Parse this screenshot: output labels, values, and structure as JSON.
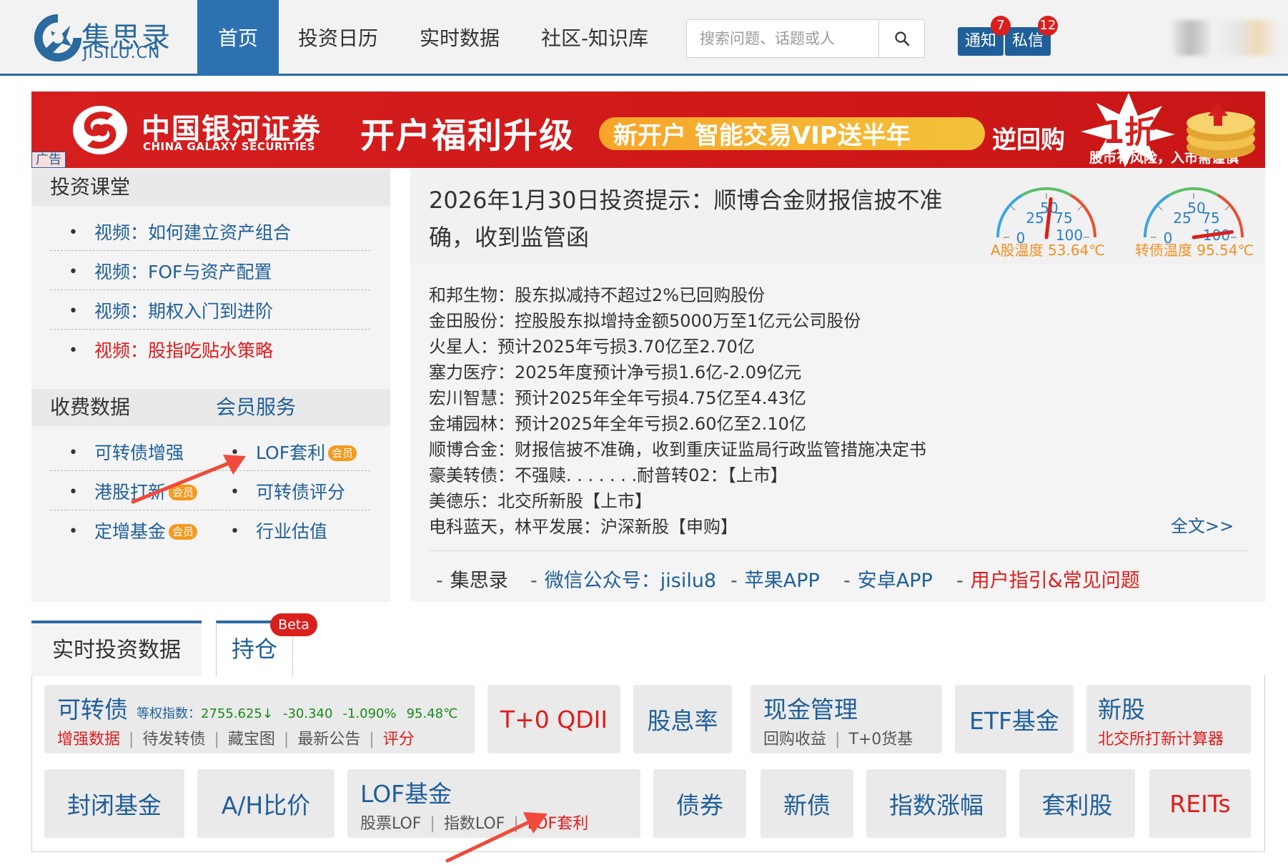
{
  "header": {
    "logo_cn": "集思录",
    "logo_en": "JISILU.CN",
    "nav": [
      "首页",
      "投资日历",
      "实时数据",
      "社区-知识库"
    ],
    "search_placeholder": "搜索问题、话题或人",
    "notice_label": "通知",
    "notice_count": "7",
    "msg_label": "私信",
    "msg_count": "12"
  },
  "banner": {
    "ad_tag": "广告",
    "brand_cn": "中国银河证券",
    "brand_en": "CHINA GALAXY SECURITIES",
    "slogan": "开户福利升级",
    "pill_text": "新开户 智能交易VIP送半年",
    "repo_text": "逆回购",
    "discount": "1折",
    "risk": "股市有风险，入市需谨慎"
  },
  "course": {
    "title": "投资课堂",
    "items": [
      {
        "label": "视频：如何建立资产组合",
        "color": "#1f5f9a"
      },
      {
        "label": "视频：FOF与资产配置",
        "color": "#1f5f9a"
      },
      {
        "label": "视频：期权入门到进阶",
        "color": "#1f5f9a"
      },
      {
        "label": "视频：股指吃贴水策略",
        "color": "#e01b1b"
      }
    ]
  },
  "fee": {
    "title": "收费数据",
    "member_label": "会员服务",
    "vip_tag": "会员",
    "rows": [
      [
        "可转债增强",
        "LOF套利"
      ],
      [
        "港股打新",
        "可转债评分"
      ],
      [
        "定增基金",
        "行业估值"
      ]
    ]
  },
  "tip": {
    "title": "2026年1月30日投资提示：顺博合金财报信披不准确，收到监管函",
    "news": [
      "和邦生物：股东拟减持不超过2%已回购股份",
      "金田股份：控股股东拟增持金额5000万至1亿元公司股份",
      "火星人：预计2025年亏损3.70亿至2.70亿",
      "塞力医疗：2025年度预计净亏损1.6亿-2.09亿元",
      "宏川智慧：预计2025年全年亏损4.75亿至4.43亿",
      "金埔园林：预计2025年全年亏损2.60亿至2.10亿",
      "顺博合金：财报信披不准确，收到重庆证监局行政监管措施决定书",
      "豪美转债：不强赎. . . . . . .耐普转02：【上市】",
      "美德乐：北交所新股【上市】",
      "电科蓝天，林平发展：沪深新股【申购】"
    ],
    "full_label": "全文>>",
    "footer_links": [
      "集思录",
      "微信公众号：jisilu8",
      "苹果APP",
      "安卓APP",
      "用户指引&常见问题"
    ]
  },
  "gauges": [
    {
      "label": "A股温度 53.64℃",
      "value": 53.64,
      "ticks": [
        "0",
        "25",
        "50",
        "75",
        "100"
      ]
    },
    {
      "label": "转债温度 95.54℃",
      "value": 95.54,
      "ticks": [
        "0",
        "25",
        "50",
        "75",
        "100"
      ]
    }
  ],
  "tabs": {
    "realtime": "实时投资数据",
    "holding": "持仓",
    "beta": "Beta"
  },
  "tiles": {
    "cb": {
      "title": "可转债",
      "index_label": "等权指数：",
      "index_value": "2755.625↓",
      "change": "-30.340",
      "change_pct": "-1.090%",
      "temp": "95.48℃",
      "links": [
        "增强数据",
        "待发转债",
        "藏宝图",
        "最新公告",
        "评分"
      ]
    },
    "qdii": "T+0 QDII",
    "dividend": "股息率",
    "cash": {
      "title": "现金管理",
      "links": [
        "回购收益",
        "T+0货基"
      ]
    },
    "etf": "ETF基金",
    "ipo": {
      "title": "新股",
      "sub": "北交所打新计算器"
    },
    "closed": "封闭基金",
    "ah": "A/H比价",
    "lof": {
      "title": "LOF基金",
      "links": [
        "股票LOF",
        "指数LOF",
        "LOF套利"
      ]
    },
    "bond": "债券",
    "newbond": "新债",
    "index": "指数涨幅",
    "arb": "套利股",
    "reits": "REITs"
  }
}
